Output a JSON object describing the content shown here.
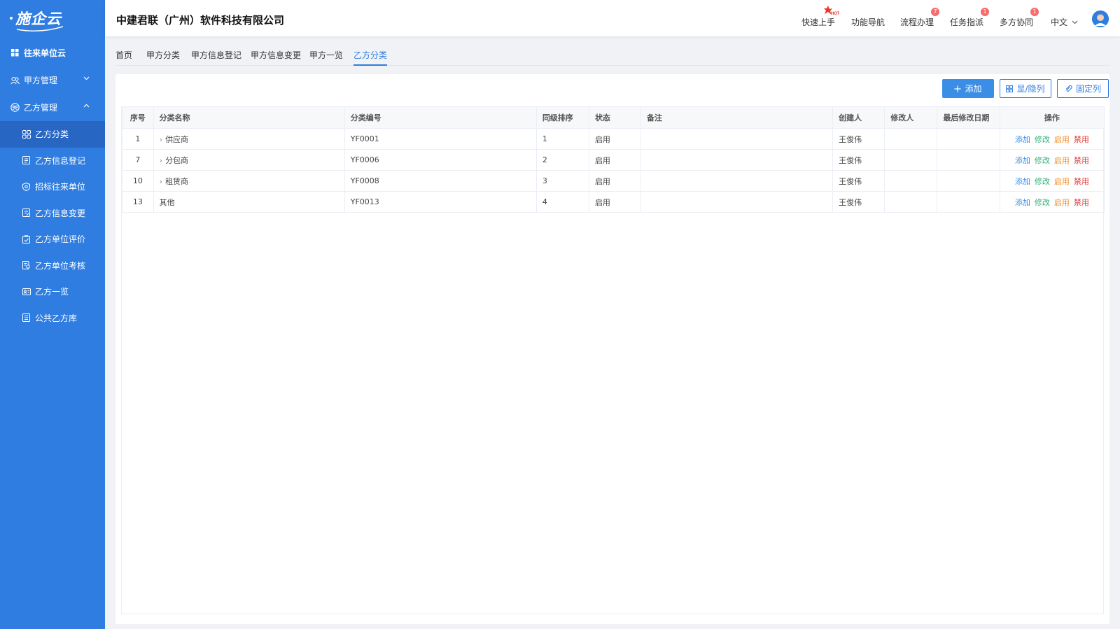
{
  "logo": {
    "text": "施企云"
  },
  "sidebar": {
    "top_item": {
      "label": "往来单位云",
      "icon": "grid-icon"
    },
    "groups": [
      {
        "label": "甲方管理",
        "icon": "users-icon",
        "expanded": false
      },
      {
        "label": "乙方管理",
        "icon": "org-icon",
        "expanded": true
      }
    ],
    "sub_items": [
      {
        "label": "乙方分类",
        "icon": "category-icon",
        "active": true
      },
      {
        "label": "乙方信息登记",
        "icon": "form-icon",
        "active": false
      },
      {
        "label": "招标往来单位",
        "icon": "shield-icon",
        "active": false
      },
      {
        "label": "乙方信息变更",
        "icon": "edit-doc-icon",
        "active": false
      },
      {
        "label": "乙方单位评价",
        "icon": "clipboard-check-icon",
        "active": false
      },
      {
        "label": "乙方单位考核",
        "icon": "doc-search-icon",
        "active": false
      },
      {
        "label": "乙方一览",
        "icon": "id-card-icon",
        "active": false
      },
      {
        "label": "公共乙方库",
        "icon": "library-icon",
        "active": false
      }
    ]
  },
  "header": {
    "company": "中建君联（广州）软件科技有限公司",
    "items": [
      {
        "label": "快速上手",
        "badge": "HOT"
      },
      {
        "label": "功能导航",
        "badge": ""
      },
      {
        "label": "流程办理",
        "badge": "7"
      },
      {
        "label": "任务指派",
        "badge": "1"
      },
      {
        "label": "多方协同",
        "badge": "1"
      }
    ],
    "language": "中文"
  },
  "tabs": [
    {
      "label": "首页",
      "active": false
    },
    {
      "label": "甲方分类",
      "active": false
    },
    {
      "label": "甲方信息登记",
      "active": false
    },
    {
      "label": "甲方信息变更",
      "active": false
    },
    {
      "label": "甲方一览",
      "active": false
    },
    {
      "label": "乙方分类",
      "active": true
    }
  ],
  "toolbar": {
    "add_label": "添加",
    "toggle_cols_label": "显/隐列",
    "fix_cols_label": "固定列"
  },
  "table": {
    "headers": [
      "序号",
      "分类名称",
      "分类编号",
      "同级排序",
      "状态",
      "备注",
      "创建人",
      "修改人",
      "最后修改日期",
      "操作"
    ],
    "rows": [
      {
        "index": "1",
        "name": "供应商",
        "expandable": true,
        "code": "YF0001",
        "order": "1",
        "status": "启用",
        "remark": "",
        "creator": "王俊伟",
        "modifier": "",
        "modified": ""
      },
      {
        "index": "7",
        "name": "分包商",
        "expandable": true,
        "code": "YF0006",
        "order": "2",
        "status": "启用",
        "remark": "",
        "creator": "王俊伟",
        "modifier": "",
        "modified": ""
      },
      {
        "index": "10",
        "name": "租赁商",
        "expandable": true,
        "code": "YF0008",
        "order": "3",
        "status": "启用",
        "remark": "",
        "creator": "王俊伟",
        "modifier": "",
        "modified": ""
      },
      {
        "index": "13",
        "name": "其他",
        "expandable": false,
        "code": "YF0013",
        "order": "4",
        "status": "启用",
        "remark": "",
        "creator": "王俊伟",
        "modifier": "",
        "modified": ""
      }
    ],
    "actions": {
      "add": "添加",
      "edit": "修改",
      "enable": "启用",
      "disable": "禁用"
    }
  }
}
